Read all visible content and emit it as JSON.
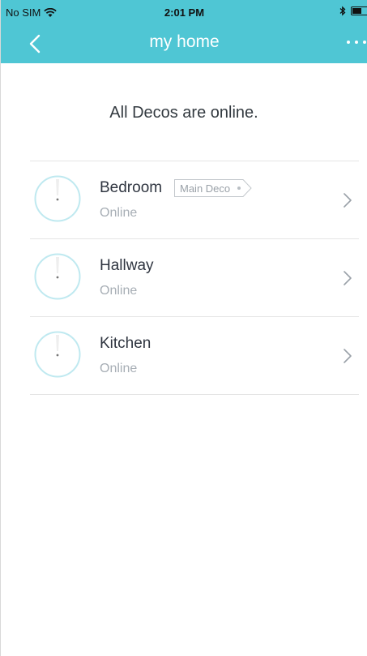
{
  "status_bar": {
    "carrier": "No SIM",
    "time": "2:01 PM"
  },
  "nav": {
    "title": "my home"
  },
  "summary": "All Decos are online.",
  "decos": [
    {
      "name": "Bedroom",
      "status": "Online",
      "badge": "Main Deco"
    },
    {
      "name": "Hallway",
      "status": "Online"
    },
    {
      "name": "Kitchen",
      "status": "Online"
    }
  ],
  "colors": {
    "accent": "#4fc6d4",
    "text_primary": "#2f3540",
    "text_secondary": "#a7aeb5",
    "divider": "#e5e5e5"
  },
  "icons": {
    "back": "chevron-left-icon",
    "more": "more-dots-icon",
    "deco": "deco-unit-icon",
    "row_arrow": "chevron-right-icon",
    "wifi": "wifi-icon",
    "bluetooth": "bluetooth-icon",
    "battery": "battery-icon"
  }
}
